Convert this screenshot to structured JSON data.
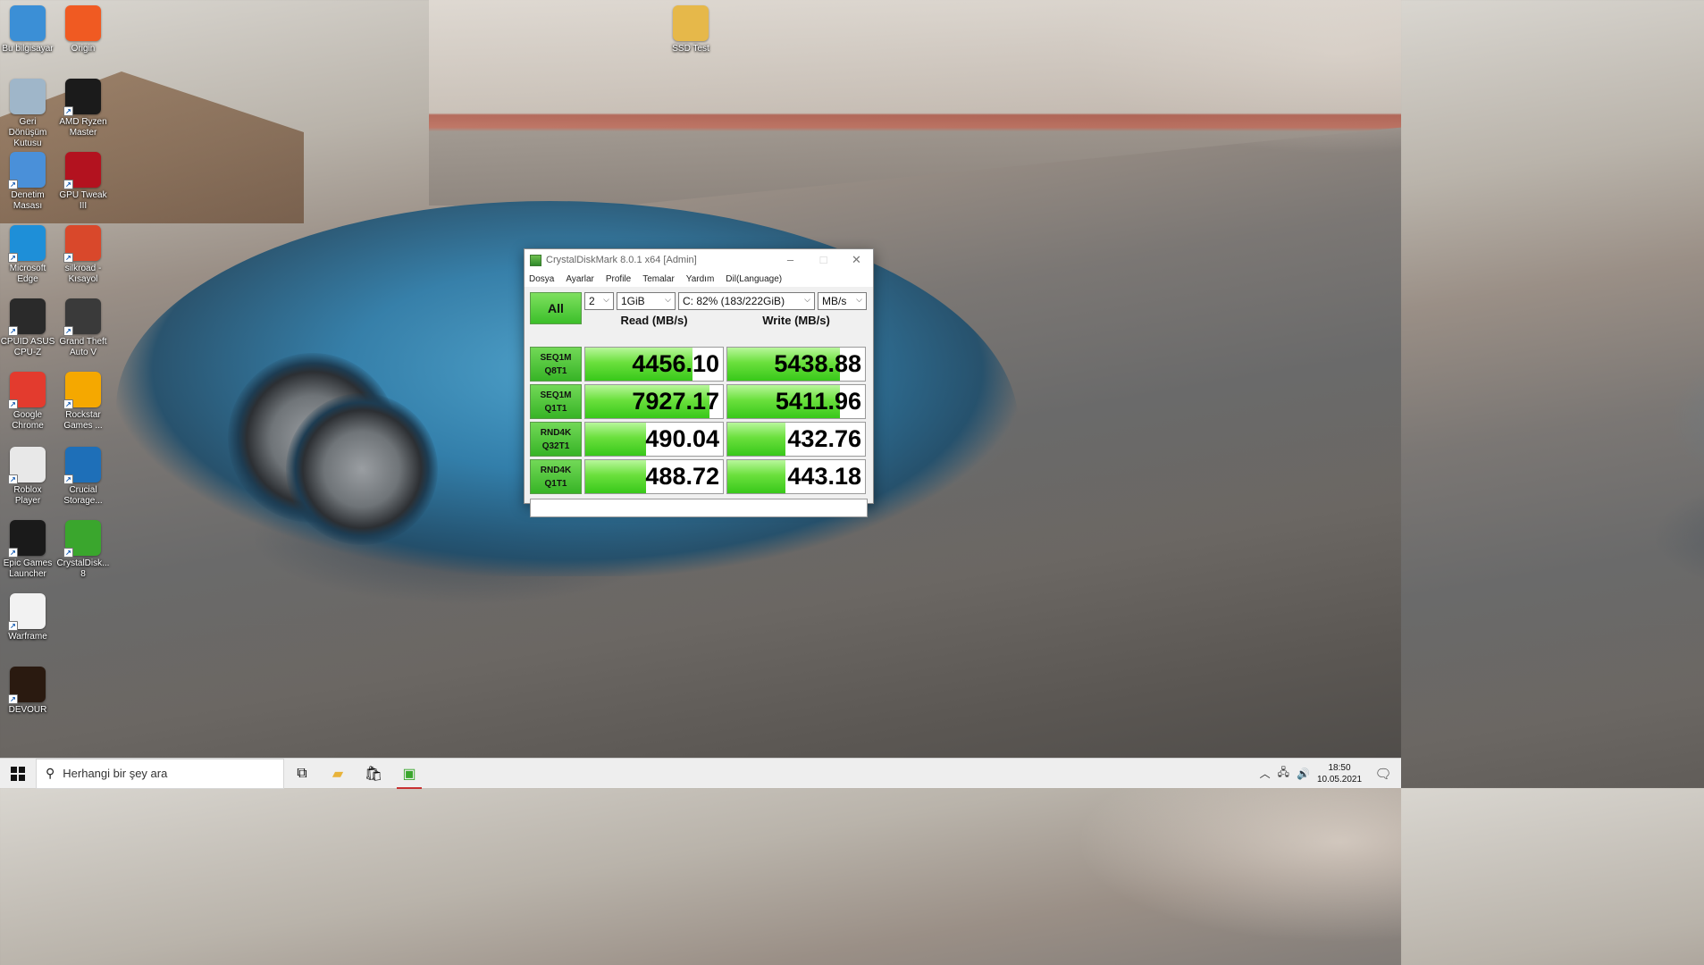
{
  "desktop": {
    "icons": [
      {
        "label": "Bu bilgisayar",
        "icon": "computer-icon",
        "color": "#3b8fd6"
      },
      {
        "label": "Origin",
        "icon": "origin-icon",
        "color": "#f05a22"
      },
      {
        "label": "Geri Dönüşüm Kutusu",
        "icon": "recycle-bin-icon",
        "color": "#9fb6c9"
      },
      {
        "label": "AMD Ryzen Master",
        "icon": "ryzen-master-icon",
        "color": "#1b1b1b"
      },
      {
        "label": "Denetim Masası",
        "icon": "control-panel-icon",
        "color": "#4a90d9"
      },
      {
        "label": "GPU Tweak III",
        "icon": "gpu-tweak-icon",
        "color": "#b3121f"
      },
      {
        "label": "Microsoft Edge",
        "icon": "edge-icon",
        "color": "#1e8fd8"
      },
      {
        "label": "silkroad - Kısayol",
        "icon": "silkroad-icon",
        "color": "#d9482b"
      },
      {
        "label": "CPUID ASUS CPU-Z",
        "icon": "cpuz-icon",
        "color": "#2a2a2a"
      },
      {
        "label": "Grand Theft Auto V",
        "icon": "gta-icon",
        "color": "#3a3a3a"
      },
      {
        "label": "Google Chrome",
        "icon": "chrome-icon",
        "color": "#e33b2e"
      },
      {
        "label": "Rockstar Games ...",
        "icon": "rockstar-icon",
        "color": "#f5a800"
      },
      {
        "label": "Roblox Player",
        "icon": "roblox-icon",
        "color": "#e8e8e8"
      },
      {
        "label": "Crucial Storage...",
        "icon": "crucial-icon",
        "color": "#1e6fb8"
      },
      {
        "label": "Epic Games Launcher",
        "icon": "epic-games-icon",
        "color": "#1a1a1a"
      },
      {
        "label": "CrystalDisk... 8",
        "icon": "crystaldisk-icon",
        "color": "#3aa62d"
      },
      {
        "label": "Warframe",
        "icon": "warframe-icon",
        "color": "#f2f2f2"
      },
      {
        "label": "DEVOUR",
        "icon": "devour-icon",
        "color": "#2a1a10"
      },
      {
        "label": "SSD Test",
        "icon": "folder-icon",
        "color": "#e6b84a"
      }
    ]
  },
  "window": {
    "title": "CrystalDiskMark 8.0.1 x64 [Admin]",
    "menu": [
      "Dosya",
      "Ayarlar",
      "Profile",
      "Temalar",
      "Yardım",
      "Dil(Language)"
    ],
    "all_button": "All",
    "count": "2",
    "size": "1GiB",
    "drive": "C: 82% (183/222GiB)",
    "unit": "MB/s",
    "read_header": "Read (MB/s)",
    "write_header": "Write (MB/s)",
    "accent": "#4ccf30",
    "tests": [
      {
        "line1": "SEQ1M",
        "line2": "Q8T1",
        "read": "4456.10",
        "write": "5438.88",
        "read_fill": 0.78,
        "write_fill": 0.82
      },
      {
        "line1": "SEQ1M",
        "line2": "Q1T1",
        "read": "7927.17",
        "write": "5411.96",
        "read_fill": 0.9,
        "write_fill": 0.82
      },
      {
        "line1": "RND4K",
        "line2": "Q32T1",
        "read": "490.04",
        "write": "432.76",
        "read_fill": 0.44,
        "write_fill": 0.42
      },
      {
        "line1": "RND4K",
        "line2": "Q1T1",
        "read": "488.72",
        "write": "443.18",
        "read_fill": 0.44,
        "write_fill": 0.42
      }
    ],
    "comment": ""
  },
  "taskbar": {
    "search_placeholder": "Herhangi bir şey ara",
    "time": "18:50",
    "date": "10.05.2021"
  }
}
